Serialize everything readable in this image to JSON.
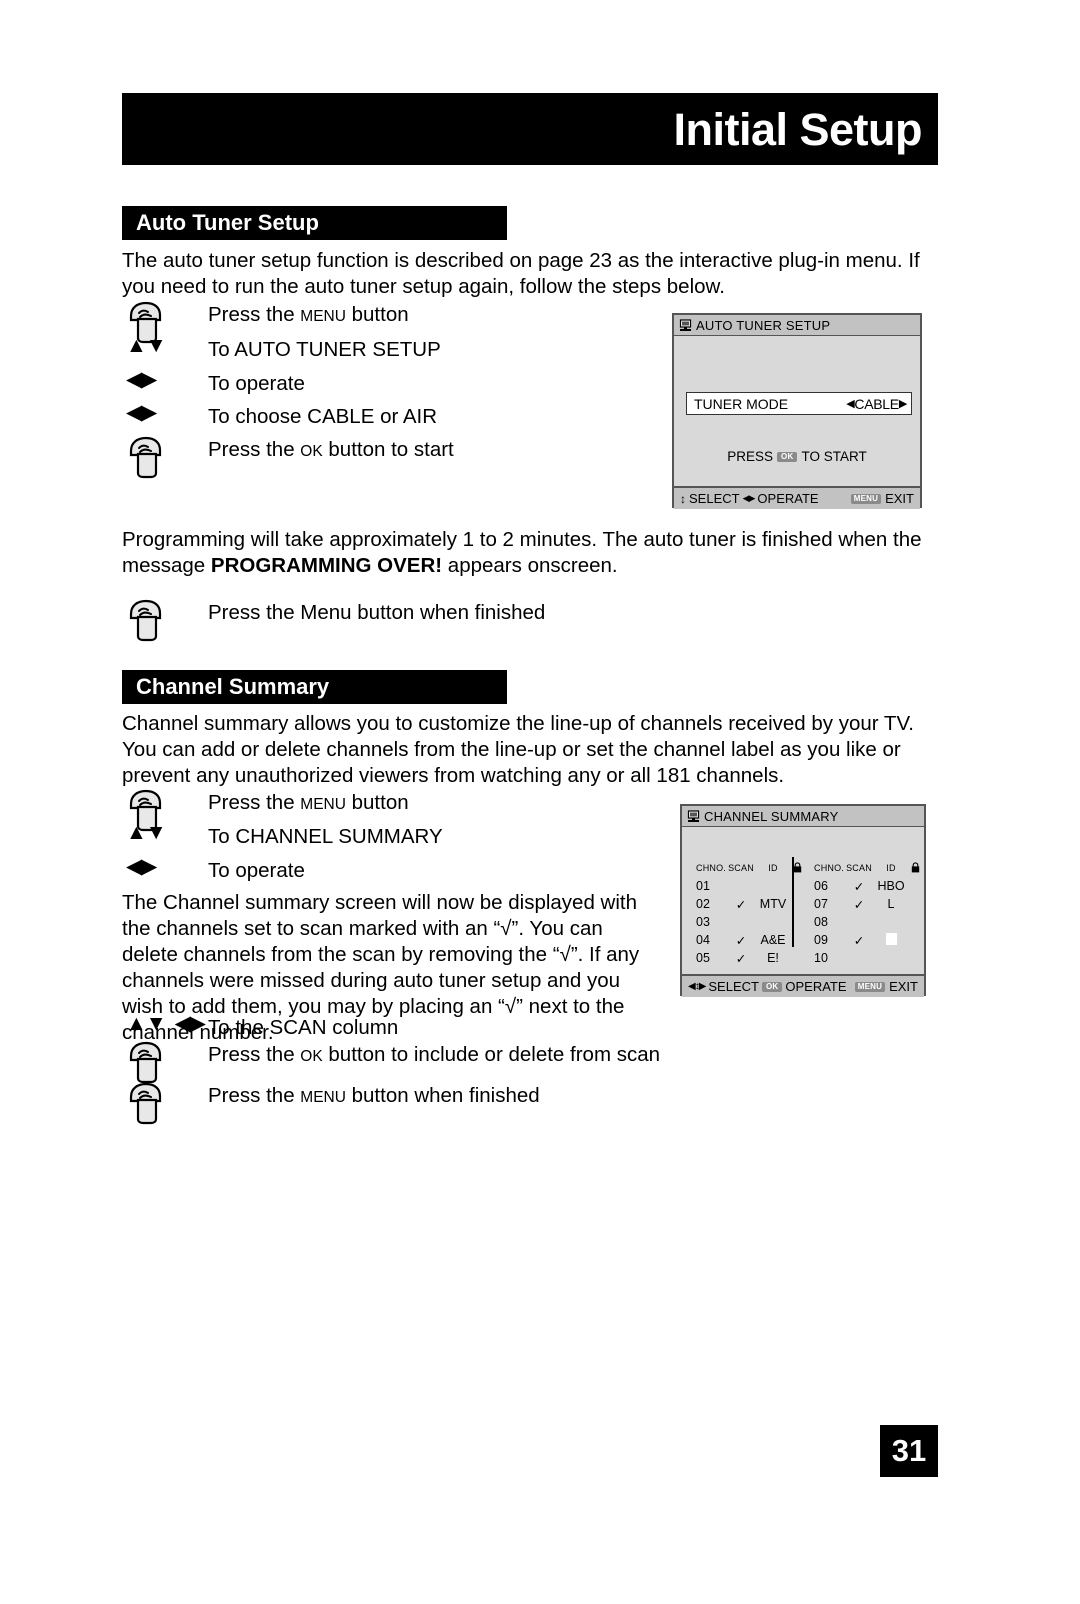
{
  "header": {
    "title": "Initial Setup"
  },
  "sections": {
    "auto_tuner": {
      "bar_title": "Auto Tuner Setup",
      "intro": "The auto tuner setup function is described on page 23 as the interactive plug-in menu.  If you need to run the auto tuner setup again, follow the steps below.",
      "steps": [
        {
          "icon": "hand-press-icon",
          "text_pre": "Press the ",
          "text_sc": "Menu",
          "text_post": " button"
        },
        {
          "icon": "arrows-up-down-icon",
          "text": "To AUTO TUNER SETUP"
        },
        {
          "icon": "arrows-left-right-icon",
          "text": "To operate"
        },
        {
          "icon": "arrows-left-right-icon",
          "text": "To choose CABLE or AIR"
        },
        {
          "icon": "hand-press-icon",
          "text_pre": "Press the ",
          "text_sc": "Ok",
          "text_post": " button to start"
        }
      ],
      "programming_note_1": "Programming will take approximately 1 to 2 minutes.  The auto tuner is finished when the message ",
      "programming_note_bold": "PROGRAMMING OVER!",
      "programming_note_2": " appears onscreen.",
      "finish_step": {
        "icon": "hand-press-icon",
        "text": "Press the Menu button when finished"
      }
    },
    "channel_summary": {
      "bar_title": "Channel Summary",
      "intro": "Channel summary allows you to customize the line-up of channels received by your TV. You can add or delete channels from the line-up or set the channel label as you like or prevent any unauthorized viewers from watching any or all 181 channels.",
      "steps": [
        {
          "icon": "hand-press-icon",
          "text_pre": "Press the ",
          "text_sc": "Menu",
          "text_post": " button"
        },
        {
          "icon": "arrows-up-down-icon",
          "text": "To CHANNEL SUMMARY"
        },
        {
          "icon": "arrows-left-right-icon",
          "text": "To operate"
        }
      ],
      "scan_note": "The Channel summary screen will now be displayed with the channels set to scan marked with an “√”. You can delete channels from the scan by removing the “√”. If any channels were missed during auto tuner setup and you wish to add them, you may by placing an “√” next to the channel number.",
      "steps_after": [
        {
          "icon": "arrows-ud-lr-icon",
          "text": "To the SCAN column"
        },
        {
          "icon": "hand-press-icon",
          "text_pre": "Press the ",
          "text_sc": "Ok",
          "text_post": " button to include or delete from scan"
        },
        {
          "icon": "hand-press-icon",
          "text_pre": "Press the ",
          "text_sc": "Menu",
          "text_post": " button when finished"
        }
      ]
    }
  },
  "osd_auto_tuner": {
    "title": "AUTO TUNER SETUP",
    "title_icon": "tv-icon",
    "row_label": "TUNER MODE",
    "row_value": "CABLE",
    "row_left_arrow": "◀",
    "row_right_arrow": "▶",
    "press_start_pre": "PRESS",
    "press_start_key": "OK",
    "press_start_post": "TO START",
    "footer_select_arrows": "↕",
    "footer_select": "SELECT",
    "footer_operate_arrows": "◀▶",
    "footer_operate": "OPERATE",
    "footer_menu_key": "MENU",
    "footer_exit": "EXIT"
  },
  "osd_channel_summary": {
    "title": "CHANNEL SUMMARY",
    "title_icon": "tv-icon",
    "headers": {
      "chno": "CHNO.",
      "scan": "SCAN",
      "id": "ID",
      "lock": "lock-icon"
    },
    "left_rows": [
      {
        "chno": "01",
        "scan": "",
        "id": ""
      },
      {
        "chno": "02",
        "scan": "✓",
        "id": "MTV"
      },
      {
        "chno": "03",
        "scan": "",
        "id": ""
      },
      {
        "chno": "04",
        "scan": "✓",
        "id": "A&E"
      },
      {
        "chno": "05",
        "scan": "✓",
        "id": "E!"
      }
    ],
    "right_rows": [
      {
        "chno": "06",
        "scan": "✓",
        "id": "HBO"
      },
      {
        "chno": "07",
        "scan": "✓",
        "id": "L"
      },
      {
        "chno": "08",
        "scan": "",
        "id": ""
      },
      {
        "chno": "09",
        "scan": "✓",
        "id": "block"
      },
      {
        "chno": "10",
        "scan": "",
        "id": ""
      }
    ],
    "footer_select_arrows": "◀↕▶",
    "footer_select": "SELECT",
    "footer_ok_key": "OK",
    "footer_operate": "OPERATE",
    "footer_menu_key": "MENU",
    "footer_exit": "EXIT"
  },
  "page_number": "31"
}
